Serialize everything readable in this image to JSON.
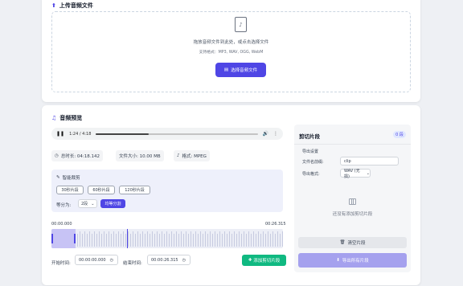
{
  "upload": {
    "title": "上传音频文件",
    "drop_text": "拖放音频文件到此处，或点击选择文件",
    "formats_text": "支持格式：MP3, WAV, OGG, WebM",
    "select_button": "选择音频文件"
  },
  "preview": {
    "title": "音频预览",
    "player": {
      "time": "1:24 / 4:18",
      "progress": 0.325
    },
    "info": {
      "duration": "总时长: 04:18.142",
      "size": "文件大小: 10.00 MB",
      "format": "格式: MPEG"
    },
    "smart": {
      "title": "智能裁剪",
      "segments": [
        "30秒片段",
        "60秒片段",
        "120秒片段"
      ],
      "split_label": "等分为:",
      "split_value": "2段",
      "split_button": "均等分割"
    },
    "timeline": {
      "start": "00:00.000",
      "end": "00:26.315"
    },
    "start_label": "开始时间:",
    "start_value": "00:00:00.000",
    "end_label": "结束时间:",
    "end_value": "00:00:26.315",
    "add_button": "添加剪切片段"
  },
  "clips": {
    "title": "剪切片段",
    "count": "0 段",
    "export_heading": "导出设置",
    "prefix_label": "文件名前缀:",
    "prefix_value": "clip",
    "format_label": "导出格式:",
    "format_value": "WAV (无损)",
    "empty_text": "还没有添加剪切片段",
    "clear_button": "清空片段",
    "export_button": "导出所有片段"
  },
  "colors": {
    "accent": "#4f46e5",
    "success": "#10b981"
  }
}
